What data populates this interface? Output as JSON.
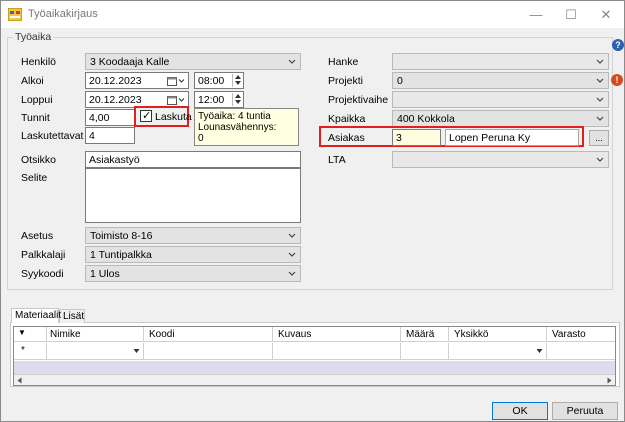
{
  "window": {
    "title": "Työaikakirjaus",
    "minimize_glyph": "—",
    "maximize_glyph": "☐",
    "close_glyph": "✕"
  },
  "group": {
    "legend": "Työaika"
  },
  "left": {
    "henkilo": {
      "label": "Henkilö",
      "value": "3 Koodaaja Kalle"
    },
    "alkoi": {
      "label": "Alkoi",
      "date": "20.12.2023",
      "time": "08:00"
    },
    "loppui": {
      "label": "Loppui",
      "date": "20.12.2023",
      "time": "12:00"
    },
    "tunnit": {
      "label": "Tunnit",
      "value": "4,00"
    },
    "laskuta": {
      "label": "Laskuta",
      "checked": true,
      "check_glyph": "✓"
    },
    "laskutettavat": {
      "label": "Laskutettavat",
      "value": "4"
    },
    "tooltip": {
      "line1": "Työaika: 4 tuntia",
      "line2": "Lounasvähennys:",
      "line3": "0"
    },
    "otsikko": {
      "label": "Otsikko",
      "value": "Asiakastyö"
    },
    "selite": {
      "label": "Selite",
      "value": ""
    },
    "asetus": {
      "label": "Asetus",
      "value": "Toimisto 8-16"
    },
    "palkkalaji": {
      "label": "Palkkalaji",
      "value": "1 Tuntipalkka"
    },
    "syykoodi": {
      "label": "Syykoodi",
      "value": "1 Ulos"
    }
  },
  "right": {
    "hanke": {
      "label": "Hanke",
      "value": ""
    },
    "projekti": {
      "label": "Projekti",
      "value": "0"
    },
    "projektivaihe": {
      "label": "Projektivaihe",
      "value": ""
    },
    "kpaikka": {
      "label": "Kpaikka",
      "value": "400 Kokkola"
    },
    "asiakas": {
      "label": "Asiakas",
      "code": "3",
      "name": "Lopen Peruna Ky",
      "browse_label": "..."
    },
    "lta": {
      "label": "LTA",
      "value": ""
    },
    "help_glyph": "?",
    "error_glyph": "!"
  },
  "tabs": [
    {
      "label": "Materiaalit",
      "active": true
    },
    {
      "label": "Lisät",
      "active": false
    }
  ],
  "grid": {
    "columns": [
      "Nimike",
      "Koodi",
      "Kuvaus",
      "Määrä",
      "Yksikkö",
      "Varasto"
    ],
    "new_row_marker": "*",
    "filter_glyph": "▼"
  },
  "buttons": {
    "ok": "OK",
    "cancel": "Peruuta"
  },
  "colors": {
    "highlight": "#e0201c",
    "accent": "#0078d7"
  }
}
